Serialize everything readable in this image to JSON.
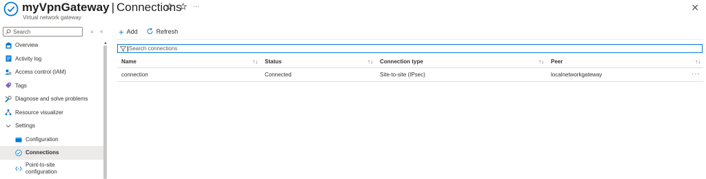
{
  "header": {
    "resource_name": "myVpnGateway",
    "separator": "|",
    "blade_title": "Connections",
    "subtitle": "Virtual network gateway",
    "ellipsis": "···",
    "close": "✕"
  },
  "sidebar": {
    "search_placeholder": "Search",
    "items": [
      {
        "label": "Overview",
        "icon": "overview-icon",
        "color": "#0078d4"
      },
      {
        "label": "Activity log",
        "icon": "activity-log-icon",
        "color": "#0078d4"
      },
      {
        "label": "Access control (IAM)",
        "icon": "iam-icon",
        "color": "#0078d4"
      },
      {
        "label": "Tags",
        "icon": "tag-icon",
        "color": "#8661c5"
      },
      {
        "label": "Diagnose and solve problems",
        "icon": "wrench-icon",
        "color": "#0078d4"
      },
      {
        "label": "Resource visualizer",
        "icon": "visualizer-icon",
        "color": "#0078d4"
      },
      {
        "label": "Settings",
        "icon": "chevron-down-icon",
        "color": "#605e5c"
      },
      {
        "label": "Configuration",
        "icon": "configuration-icon",
        "color": "#0078d4"
      },
      {
        "label": "Connections",
        "icon": "connections-icon",
        "color": "#0078d4",
        "active": true
      },
      {
        "label": "Point-to-site configuration",
        "icon": "code-icon",
        "color": "#0078d4"
      }
    ]
  },
  "toolbar": {
    "add_label": "Add",
    "refresh_label": "Refresh"
  },
  "filter": {
    "placeholder": "Search connections"
  },
  "table": {
    "columns": [
      "Name",
      "Status",
      "Connection type",
      "Peer"
    ],
    "rows": [
      {
        "name": "connection",
        "status": "Connected",
        "type": "Site-to-site (IPsec)",
        "peer": "localnetworkgateway",
        "more": "···"
      }
    ]
  },
  "colors": {
    "accent": "#0078d4",
    "active_bg": "#edebe9",
    "border": "#e1dfdd"
  }
}
